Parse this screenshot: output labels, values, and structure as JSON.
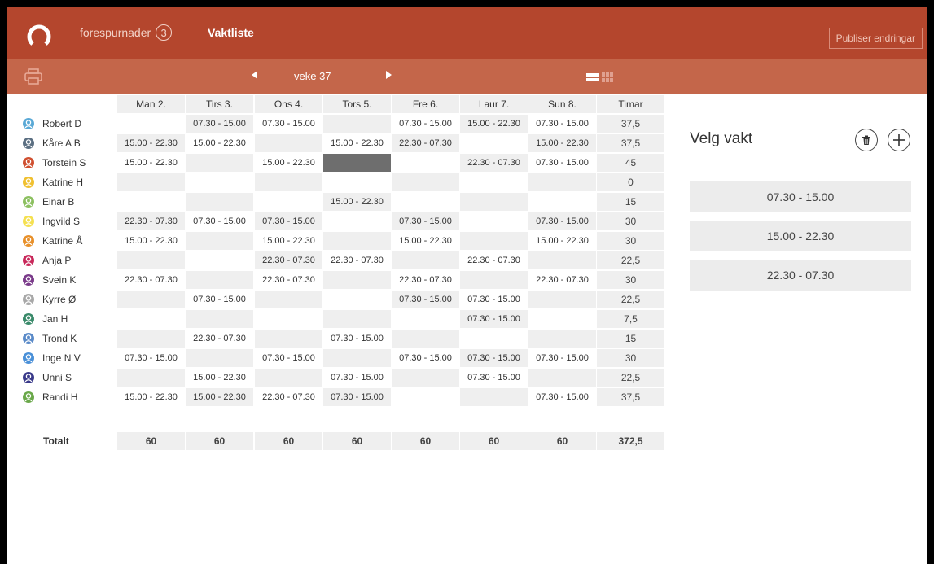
{
  "topbar": {
    "requests_label": "forespurnader",
    "requests_count": "3",
    "roster_label": "Vaktliste",
    "publish_label": "Publiser endringar"
  },
  "week": {
    "label": "veke 37"
  },
  "colors": {
    "brand": "#b4462d",
    "subbar": "#c4664a",
    "selected_cell": "#6e6e6e",
    "cell_shade": "#efefef"
  },
  "table": {
    "headers": [
      "Man 2.",
      "Tirs 3.",
      "Ons 4.",
      "Tors 5.",
      "Fre 6.",
      "Laur 7.",
      "Sun 8.",
      "Timar"
    ],
    "rows": [
      {
        "name": "Robert D",
        "avatar": "#5aa9d6",
        "shifts": [
          "",
          "07.30 - 15.00",
          "07.30 - 15.00",
          "",
          "07.30 - 15.00",
          "15.00 - 22.30",
          "07.30 - 15.00"
        ],
        "hours": "37,5"
      },
      {
        "name": "Kåre A B",
        "avatar": "#5b6f82",
        "shifts": [
          "15.00 - 22.30",
          "15.00 - 22.30",
          "",
          "15.00 - 22.30",
          "22.30 - 07.30",
          "",
          "15.00 - 22.30"
        ],
        "hours": "37,5"
      },
      {
        "name": "Torstein S",
        "avatar": "#d05030",
        "shifts": [
          "15.00 - 22.30",
          "",
          "15.00 - 22.30",
          "",
          "",
          "22.30 - 07.30",
          "07.30 - 15.00"
        ],
        "hours": "45"
      },
      {
        "name": "Katrine H",
        "avatar": "#f0c030",
        "shifts": [
          "",
          "",
          "",
          "",
          "",
          "",
          ""
        ],
        "hours": "0"
      },
      {
        "name": "Einar B",
        "avatar": "#8cc060",
        "shifts": [
          "",
          "",
          "",
          "15.00 - 22.30",
          "",
          "",
          ""
        ],
        "hours": "15"
      },
      {
        "name": "Ingvild S",
        "avatar": "#f5e050",
        "shifts": [
          "22.30 - 07.30",
          "07.30 - 15.00",
          "07.30 - 15.00",
          "",
          "07.30 - 15.00",
          "",
          "07.30 - 15.00"
        ],
        "hours": "30"
      },
      {
        "name": "Katrine Å",
        "avatar": "#e8902a",
        "shifts": [
          "15.00 - 22.30",
          "",
          "15.00 - 22.30",
          "",
          "15.00 - 22.30",
          "",
          "15.00 - 22.30"
        ],
        "hours": "30"
      },
      {
        "name": "Anja P",
        "avatar": "#c8285a",
        "shifts": [
          "",
          "",
          "22.30 - 07.30",
          "22.30 - 07.30",
          "",
          "22.30 - 07.30",
          ""
        ],
        "hours": "22,5"
      },
      {
        "name": "Svein K",
        "avatar": "#7a3a8a",
        "shifts": [
          "22.30 - 07.30",
          "",
          "22.30 - 07.30",
          "",
          "22.30 - 07.30",
          "",
          "22.30 - 07.30"
        ],
        "hours": "30"
      },
      {
        "name": "Kyrre Ø",
        "avatar": "#a8a8a8",
        "shifts": [
          "",
          "07.30 - 15.00",
          "",
          "",
          "07.30 - 15.00",
          "07.30 - 15.00",
          ""
        ],
        "hours": "22,5"
      },
      {
        "name": "Jan H",
        "avatar": "#3a8a6a",
        "shifts": [
          "",
          "",
          "",
          "",
          "",
          "07.30 - 15.00",
          ""
        ],
        "hours": "7,5"
      },
      {
        "name": "Trond K",
        "avatar": "#5a8ac8",
        "shifts": [
          "",
          "22.30 - 07.30",
          "",
          "07.30 - 15.00",
          "",
          "",
          ""
        ],
        "hours": "15"
      },
      {
        "name": "Inge N V",
        "avatar": "#4a90d8",
        "shifts": [
          "07.30 - 15.00",
          "",
          "07.30 - 15.00",
          "",
          "07.30 - 15.00",
          "07.30 - 15.00",
          "07.30 - 15.00"
        ],
        "hours": "30"
      },
      {
        "name": "Unni S",
        "avatar": "#3a3a8a",
        "shifts": [
          "",
          "15.00 - 22.30",
          "",
          "07.30 - 15.00",
          "",
          "07.30 - 15.00",
          ""
        ],
        "hours": "22,5"
      },
      {
        "name": "Randi H",
        "avatar": "#6aa84a",
        "shifts": [
          "15.00 - 22.30",
          "15.00 - 22.30",
          "22.30 - 07.30",
          "07.30 - 15.00",
          "",
          "",
          "07.30 - 15.00"
        ],
        "hours": "37,5"
      }
    ],
    "total_label": "Totalt",
    "totals": [
      "60",
      "60",
      "60",
      "60",
      "60",
      "60",
      "60",
      "372,5"
    ]
  },
  "panel": {
    "title": "Velg vakt",
    "shifts": [
      "07.30 - 15.00",
      "15.00 - 22.30",
      "22.30 - 07.30"
    ]
  }
}
